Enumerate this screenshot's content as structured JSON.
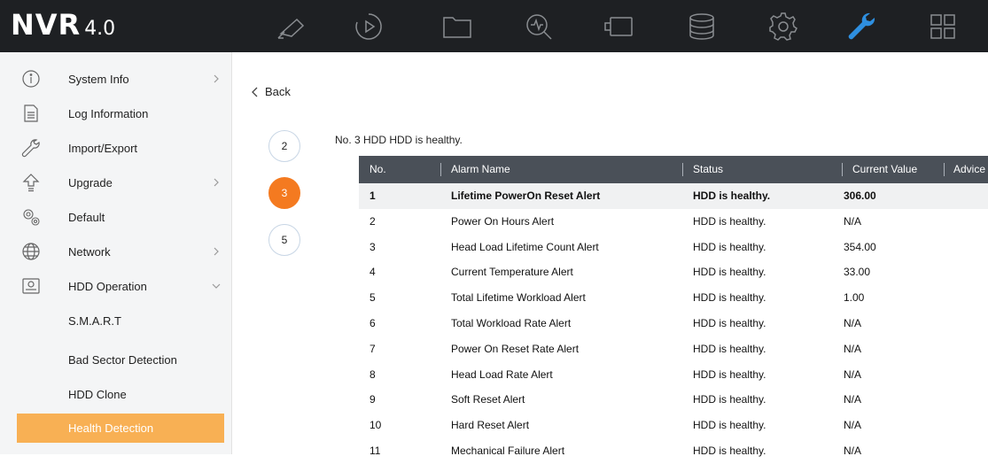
{
  "app": {
    "brand": "NVR",
    "version": "4.0"
  },
  "topnav": [
    "live-view-icon",
    "playback-icon",
    "file-management-icon",
    "smart-analysis-icon",
    "camera-icon",
    "storage-icon",
    "configuration-icon",
    "maintenance-icon",
    "menu-grid-icon"
  ],
  "accent": "#f47a20",
  "sidebar": {
    "items": [
      {
        "label": "System Info",
        "icon": "info-icon"
      },
      {
        "label": "Log Information",
        "icon": "document-icon"
      },
      {
        "label": "Import/Export",
        "icon": "wrench-icon"
      },
      {
        "label": "Upgrade",
        "icon": "upgrade-icon"
      },
      {
        "label": "Default",
        "icon": "gears-icon"
      },
      {
        "label": "Network",
        "icon": "globe-icon"
      },
      {
        "label": "HDD Operation",
        "icon": "hdd-icon"
      },
      {
        "label": "S.M.A.R.T"
      },
      {
        "label": "Bad Sector Detection"
      },
      {
        "label": "HDD Clone"
      },
      {
        "label": "Health Detection"
      }
    ]
  },
  "back_label": "Back",
  "steps": [
    "2",
    "3",
    "5"
  ],
  "health_title": "No. 3 HDD  HDD is healthy.",
  "table": {
    "headers": [
      "No.",
      "Alarm Name",
      "Status",
      "Current Value",
      "Advice"
    ],
    "rows": [
      [
        "1",
        "Lifetime PowerOn Reset Alert",
        "HDD is healthy.",
        "306.00"
      ],
      [
        "2",
        "Power On Hours Alert",
        "HDD is healthy.",
        "N/A"
      ],
      [
        "3",
        "Head Load Lifetime Count Alert",
        "HDD is healthy.",
        "354.00"
      ],
      [
        "4",
        "Current Temperature Alert",
        "HDD is healthy.",
        "33.00"
      ],
      [
        "5",
        "Total Lifetime Workload Alert",
        "HDD is healthy.",
        "1.00"
      ],
      [
        "6",
        "Total Workload Rate Alert",
        "HDD is healthy.",
        "N/A"
      ],
      [
        "7",
        "Power On Reset Rate Alert",
        "HDD is healthy.",
        "N/A"
      ],
      [
        "8",
        "Head Load Rate Alert",
        "HDD is healthy.",
        "N/A"
      ],
      [
        "9",
        "Soft Reset Alert",
        "HDD is healthy.",
        "N/A"
      ],
      [
        "10",
        "Hard Reset Alert",
        "HDD is healthy.",
        "N/A"
      ],
      [
        "11",
        "Mechanical Failure Alert",
        "HDD is healthy.",
        "N/A"
      ]
    ]
  }
}
